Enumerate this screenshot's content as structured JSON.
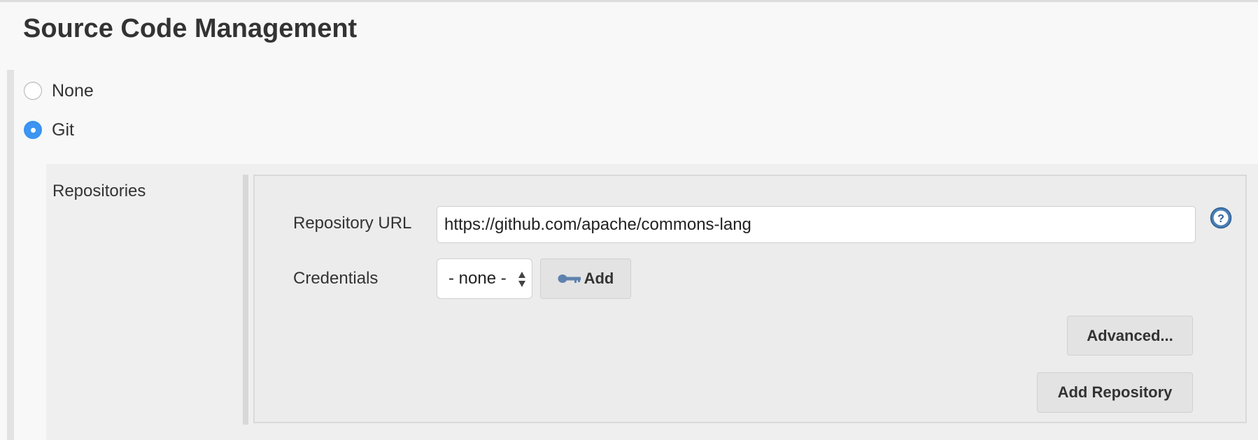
{
  "section": {
    "title": "Source Code Management"
  },
  "scm_options": [
    {
      "label": "None",
      "selected": false
    },
    {
      "label": "Git",
      "selected": true
    }
  ],
  "git": {
    "repositories_label": "Repositories",
    "repository_url": {
      "label": "Repository URL",
      "value": "https://github.com/apache/commons-lang"
    },
    "credentials": {
      "label": "Credentials",
      "selected": "- none -",
      "add_label": "Add"
    },
    "advanced_label": "Advanced...",
    "add_repository_label": "Add Repository"
  },
  "icons": {
    "help": "help-icon",
    "key": "key-icon",
    "select_arrows": "up-down-arrows-icon"
  },
  "colors": {
    "accent": "#3d95f3",
    "help_icon": "#4a7fb5",
    "key_icon": "#5f82ad"
  }
}
